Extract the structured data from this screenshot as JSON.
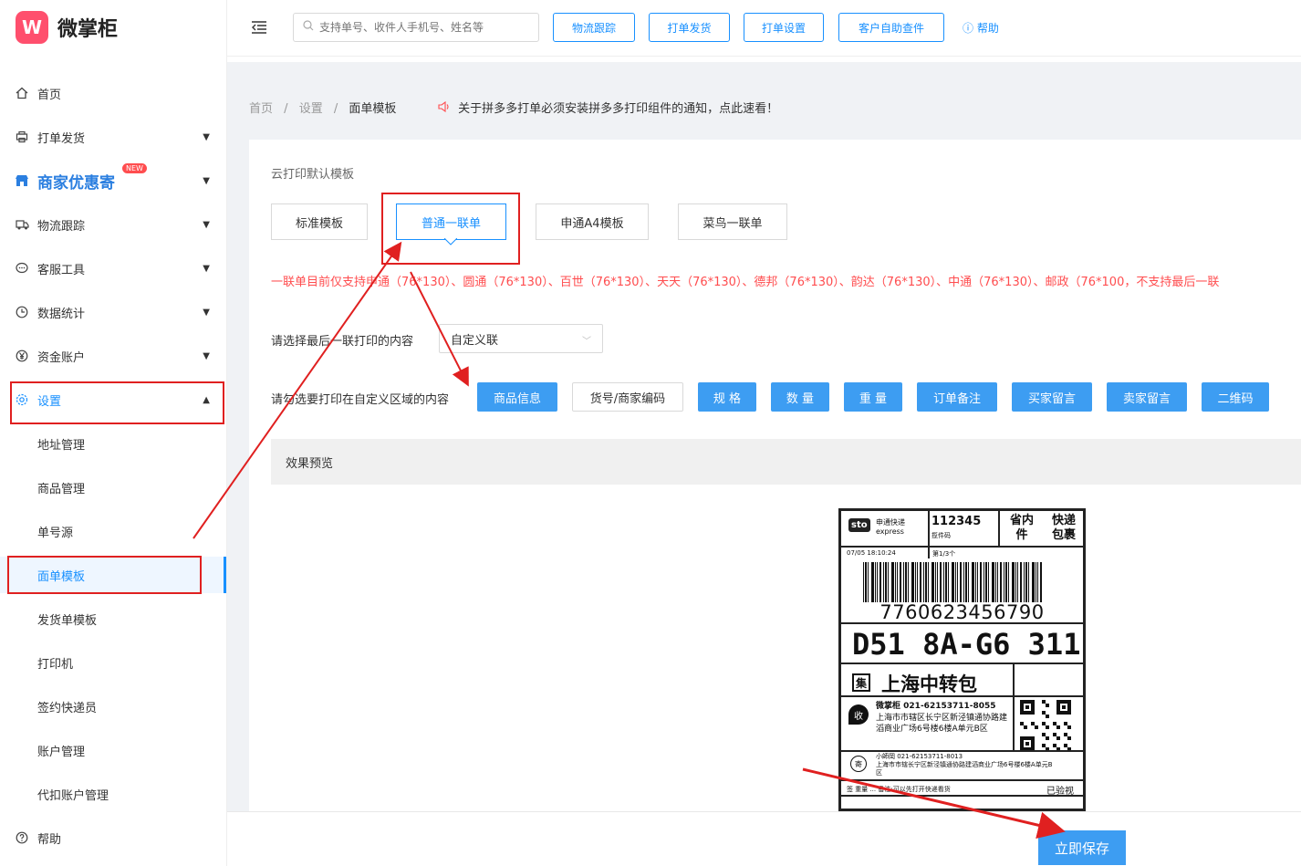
{
  "app": {
    "logo_text": "微掌柜",
    "logo_mark": "W"
  },
  "sidebar": {
    "items": [
      {
        "label": "首页",
        "icon": "home-icon"
      },
      {
        "label": "打单发货",
        "icon": "print-icon"
      },
      {
        "label": "商家优惠寄",
        "icon": "shop-icon",
        "badge": "NEW"
      },
      {
        "label": "物流跟踪",
        "icon": "truck-icon"
      },
      {
        "label": "客服工具",
        "icon": "chat-icon"
      },
      {
        "label": "数据统计",
        "icon": "clock-icon"
      },
      {
        "label": "资金账户",
        "icon": "yen-icon"
      },
      {
        "label": "设置",
        "icon": "gear-icon"
      }
    ],
    "settings_sub": [
      "地址管理",
      "商品管理",
      "单号源",
      "面单模板",
      "发货单模板",
      "打印机",
      "签约快递员",
      "账户管理",
      "代扣账户管理"
    ],
    "help": "帮助"
  },
  "topbar": {
    "search_placeholder": "支持单号、收件人手机号、姓名等",
    "buttons": [
      "物流跟踪",
      "打单发货",
      "打单设置",
      "客户自助查件"
    ],
    "help": "帮助"
  },
  "breadcrumb": {
    "home": "首页",
    "sep": "/",
    "settings": "设置",
    "current": "面单模板"
  },
  "notice": "关于拼多多打单必须安装拼多多打印组件的通知，点此速看！",
  "card": {
    "title": "云打印默认模板",
    "templates": [
      "标准模板",
      "普通一联单",
      "申通A4模板",
      "菜鸟一联单"
    ],
    "active_template": "普通一联单",
    "red_note": "一联单目前仅支持申通（76*130）、圆通（76*130）、百世（76*130）、天天（76*130）、德邦（76*130）、韵达（76*130）、中通（76*130）、邮政（76*100，不支持最后一联",
    "select_label": "请选择最后一联打印的内容",
    "select_value": "自定义联",
    "fields_label": "请勾选要打印在自定义区域的内容",
    "fields": [
      "商品信息",
      "货号/商家编码",
      "规 格",
      "数 量",
      "重 量",
      "订单备注",
      "买家留言",
      "卖家留言",
      "二维码"
    ],
    "preview_title": "效果预览"
  },
  "waybill": {
    "carrier": "sto",
    "carrier_cn": "申通快递",
    "carrier_en": "express",
    "code_top": "112345",
    "code_sub": "揽件码",
    "tag1": "省内件",
    "tag2": "快递包裹",
    "datetime": "07/05 18:10:24",
    "page": "第1/3个",
    "tracking": "7760623456790",
    "sort_code": "D51 8A-G6 311",
    "hub_mark": "集",
    "hub": "上海中转包",
    "recv_mark": "收",
    "recv_name": "微掌柜",
    "recv_phone": "021-62153711-8055",
    "recv_addr": "上海市市辖区长宁区新泾镇通协路建滔商业广场6号楼6楼A单元B区",
    "send_mark": "寄",
    "send_line": "小師岡 021-62153711-8013",
    "send_addr": "上海市市辖长宁区新泾镇通协路建滔商业广场6号楼6楼A单元B区",
    "footer_note": "签 重量 ... 备注:可以先打开快递看货",
    "inspected": "已验视"
  },
  "save_button": "立即保存",
  "annotation_color": "#e02020"
}
